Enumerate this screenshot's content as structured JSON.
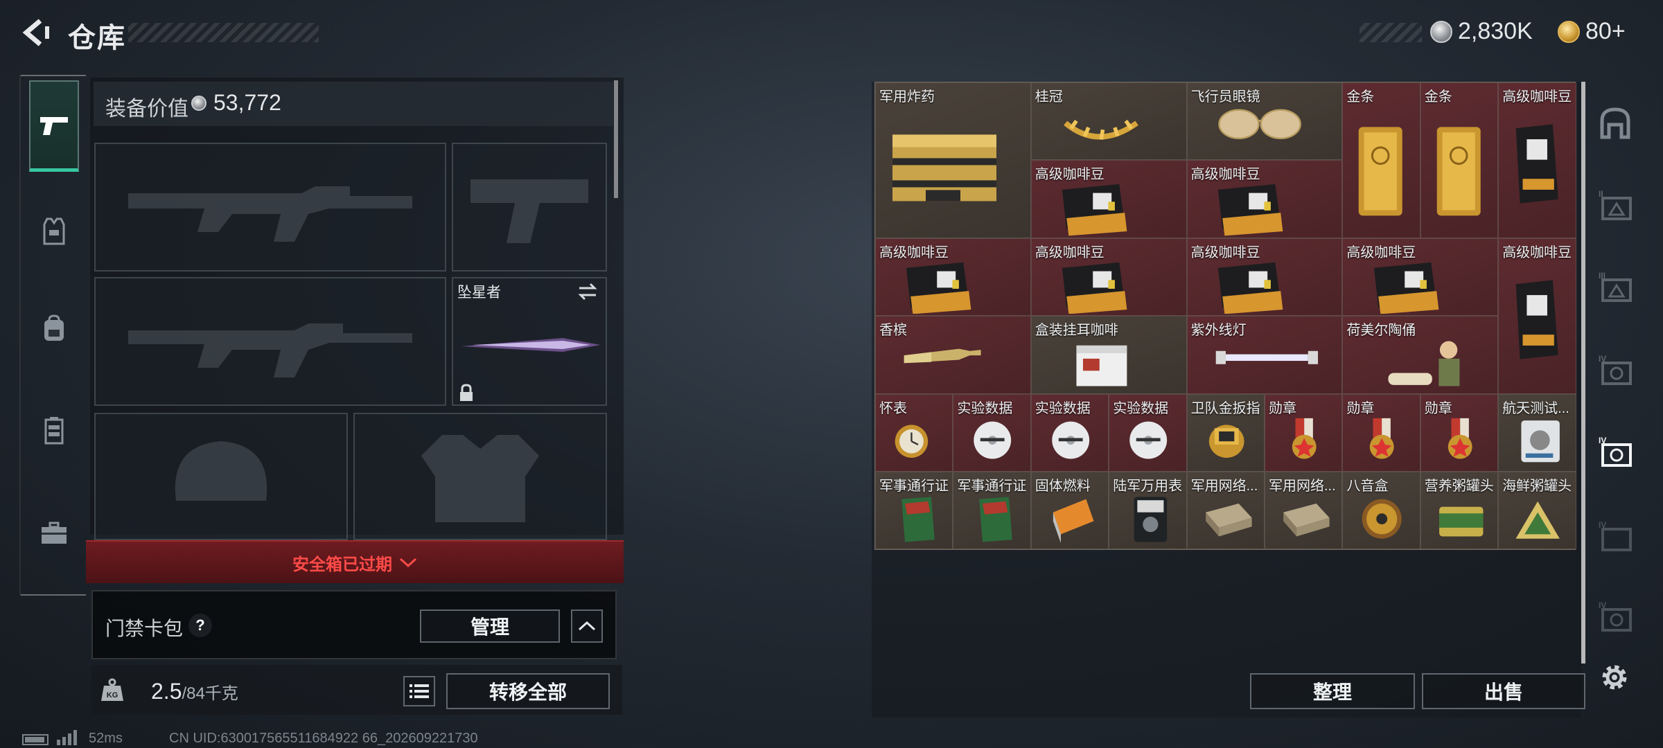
{
  "header": {
    "title": "仓库",
    "currencies": [
      {
        "value": "2,830K",
        "icon": "silver-coin-icon"
      },
      {
        "value": "80+",
        "icon": "gold-coin-icon"
      }
    ]
  },
  "left_nav": {
    "items": [
      {
        "name": "weapons",
        "icon": "pistol-icon",
        "active": true
      },
      {
        "name": "armor",
        "icon": "vest-icon",
        "active": false
      },
      {
        "name": "backpack",
        "icon": "backpack-icon",
        "active": false
      },
      {
        "name": "rig",
        "icon": "chest-rig-icon",
        "active": false
      },
      {
        "name": "toolbox",
        "icon": "toolbox-icon",
        "active": false
      }
    ]
  },
  "equipment": {
    "label": "装备价值",
    "value": "53,772",
    "melee_label": "坠星者",
    "safe_box_status": "安全箱已过期",
    "keycard_label": "门禁卡包",
    "help_label": "?",
    "manage_label": "管理",
    "weight_value": "2.5",
    "weight_cap": "/84千克",
    "transfer_label": "转移全部"
  },
  "inventory": {
    "items": [
      {
        "label": "军用炸药",
        "icon": "explosive-crate-icon"
      },
      {
        "label": "桂冠",
        "icon": "laurel-crown-icon"
      },
      {
        "label": "飞行员眼镜",
        "icon": "aviator-glasses-icon"
      },
      {
        "label": "金条",
        "icon": "gold-bar-icon"
      },
      {
        "label": "金条",
        "icon": "gold-bar-icon"
      },
      {
        "label": "高级咖啡豆",
        "icon": "coffee-bag-icon"
      },
      {
        "label": "高级咖啡豆",
        "icon": "coffee-bag-icon"
      },
      {
        "label": "高级咖啡豆",
        "icon": "coffee-bag-icon"
      },
      {
        "label": "高级咖啡豆",
        "icon": "coffee-bag-icon"
      },
      {
        "label": "高级咖啡豆",
        "icon": "coffee-bag-icon"
      },
      {
        "label": "高级咖啡豆",
        "icon": "coffee-bag-icon"
      },
      {
        "label": "高级咖啡豆",
        "icon": "coffee-bag-icon"
      },
      {
        "label": "高级咖啡豆",
        "icon": "coffee-bag-icon"
      },
      {
        "label": "香槟",
        "icon": "champagne-icon"
      },
      {
        "label": "盒装挂耳咖啡",
        "icon": "coffee-box-icon"
      },
      {
        "label": "紫外线灯",
        "icon": "uv-lamp-icon"
      },
      {
        "label": "荷美尔陶俑",
        "icon": "figurine-icon"
      },
      {
        "label": "怀表",
        "icon": "pocket-watch-icon"
      },
      {
        "label": "实验数据",
        "icon": "disc-icon"
      },
      {
        "label": "实验数据",
        "icon": "disc-icon"
      },
      {
        "label": "实验数据",
        "icon": "disc-icon"
      },
      {
        "label": "卫队金扳指",
        "icon": "gold-ring-icon"
      },
      {
        "label": "勋章",
        "icon": "medal-icon"
      },
      {
        "label": "勋章",
        "icon": "medal-icon"
      },
      {
        "label": "勋章",
        "icon": "medal-icon"
      },
      {
        "label": "航天测试...",
        "icon": "device-icon"
      },
      {
        "label": "军事通行证",
        "icon": "passbook-icon"
      },
      {
        "label": "军事通行证",
        "icon": "passbook-icon"
      },
      {
        "label": "固体燃料",
        "icon": "fuel-block-icon"
      },
      {
        "label": "陆军万用表",
        "icon": "multimeter-icon"
      },
      {
        "label": "军用网络...",
        "icon": "network-module-icon"
      },
      {
        "label": "军用网络...",
        "icon": "network-module-icon"
      },
      {
        "label": "八音盒",
        "icon": "music-box-icon"
      },
      {
        "label": "营养粥罐头",
        "icon": "porridge-can-icon"
      },
      {
        "label": "海鲜粥罐头",
        "icon": "seafood-can-icon"
      }
    ],
    "sort_label": "整理",
    "sell_label": "出售"
  },
  "right_tabs": [
    {
      "name": "home",
      "icon": "home-tab-icon"
    },
    {
      "name": "case-2",
      "icon": "case-ii-icon"
    },
    {
      "name": "case-3",
      "icon": "case-iii-icon"
    },
    {
      "name": "case-4a",
      "icon": "case-iv-icon"
    },
    {
      "name": "case-4b",
      "icon": "case-iv-active-icon"
    },
    {
      "name": "case-4c",
      "icon": "case-iv-icon"
    },
    {
      "name": "case-4d",
      "icon": "case-iv-icon"
    }
  ],
  "footer": {
    "ping": "52ms",
    "uid": "CN UID:630017565511684922 66_202609221730"
  },
  "colors": {
    "accent": "#37c7a3",
    "alert": "#ff4b48",
    "maroon_cell": "#5d2b30",
    "tan_cell": "#4a423a"
  }
}
